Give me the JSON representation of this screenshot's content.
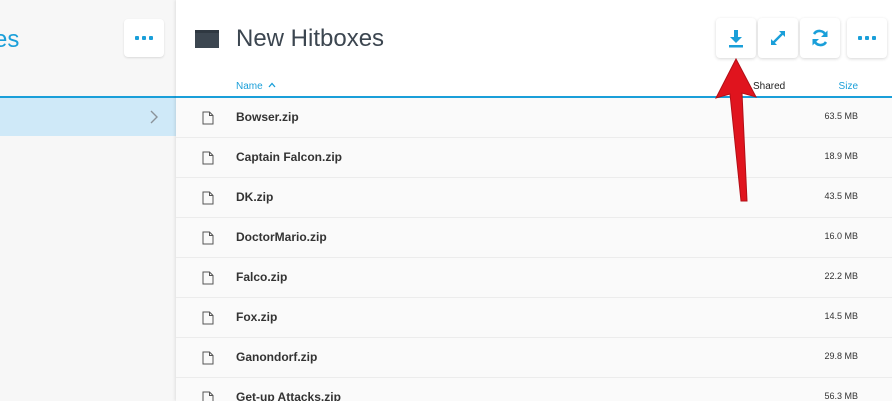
{
  "sidebar": {
    "title_fragment": "es",
    "more_icon": "more-horizontal-icon"
  },
  "header": {
    "folder_icon": "folder-icon",
    "title": "New Hitboxes",
    "actions": [
      {
        "icon": "download-icon"
      },
      {
        "icon": "expand-icon"
      },
      {
        "icon": "refresh-icon"
      },
      {
        "icon": "more-horizontal-icon"
      }
    ]
  },
  "table": {
    "columns": {
      "name": "Name",
      "shared": "Shared",
      "size": "Size"
    },
    "sort": "name-ascending",
    "rows": [
      {
        "name": "Bowser.zip",
        "size": "63.5 MB"
      },
      {
        "name": "Captain Falcon.zip",
        "size": "18.9 MB"
      },
      {
        "name": "DK.zip",
        "size": "43.5 MB"
      },
      {
        "name": "DoctorMario.zip",
        "size": "16.0 MB"
      },
      {
        "name": "Falco.zip",
        "size": "22.2 MB"
      },
      {
        "name": "Fox.zip",
        "size": "14.5 MB"
      },
      {
        "name": "Ganondorf.zip",
        "size": "29.8 MB"
      },
      {
        "name": "Get-up Attacks.zip",
        "size": "56.3 MB"
      }
    ]
  },
  "colors": {
    "accent": "#1a9fd9",
    "selected_row": "#cfe9f8",
    "annotation_arrow": "#e0141e"
  }
}
